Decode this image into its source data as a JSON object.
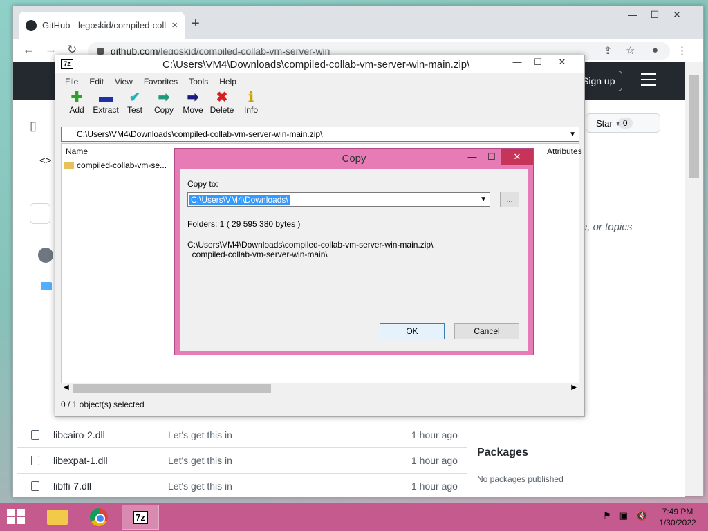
{
  "browser": {
    "tab_title": "GitHub - legoskid/compiled-collab-vm-server-win",
    "tab_close": "×",
    "new_tab": "+",
    "url_host": "github.com",
    "url_path": "/legoskid/compiled-collab-vm-server-win",
    "win_min": "—",
    "win_max": "☐",
    "win_close": "✕"
  },
  "github": {
    "sign_up": "Sign up",
    "star_label": "Star",
    "star_count": "0",
    "topics_text": "site, or topics",
    "code_tab_icon": "<>",
    "files": [
      {
        "name": "libcairo-2.dll",
        "message": "Let's get this in",
        "time": "1 hour ago"
      },
      {
        "name": "libexpat-1.dll",
        "message": "Let's get this in",
        "time": "1 hour ago"
      },
      {
        "name": "libffi-7.dll",
        "message": "Let's get this in",
        "time": "1 hour ago"
      }
    ],
    "packages_heading": "Packages",
    "packages_empty": "No packages published"
  },
  "zip": {
    "icon_text": "7z",
    "title": "C:\\Users\\VM4\\Downloads\\compiled-collab-vm-server-win-main.zip\\",
    "menu": [
      "File",
      "Edit",
      "View",
      "Favorites",
      "Tools",
      "Help"
    ],
    "tools": [
      {
        "label": "Add",
        "icon": "plus-icon",
        "glyph": "✚",
        "color": "#2aa52a"
      },
      {
        "label": "Extract",
        "icon": "minus-icon",
        "glyph": "▬",
        "color": "#1f2fa8"
      },
      {
        "label": "Test",
        "icon": "test-check-icon",
        "glyph": "✔",
        "color": "#22b5b5"
      },
      {
        "label": "Copy",
        "icon": "copy-arrow-icon",
        "glyph": "➡",
        "color": "#1e9a7a"
      },
      {
        "label": "Move",
        "icon": "move-arrow-icon",
        "glyph": "➡",
        "color": "#1a1a80"
      },
      {
        "label": "Delete",
        "icon": "delete-x-icon",
        "glyph": "✖",
        "color": "#d42020"
      },
      {
        "label": "Info",
        "icon": "info-icon",
        "glyph": "ℹ",
        "color": "#c9a400"
      }
    ],
    "address": "C:\\Users\\VM4\\Downloads\\compiled-collab-vm-server-win-main.zip\\",
    "col_name": "Name",
    "col_attributes": "Attributes",
    "item_name": "compiled-collab-vm-se...",
    "status": "0 / 1 object(s) selected"
  },
  "copy_dialog": {
    "title": "Copy",
    "copy_to_label": "Copy to:",
    "copy_to_value": "C:\\Users\\VM4\\Downloads\\",
    "browse_label": "...",
    "folders_info": "Folders: 1    ( 29 595 380 bytes )",
    "path_line1": "C:\\Users\\VM4\\Downloads\\compiled-collab-vm-server-win-main.zip\\",
    "path_line2": "  compiled-collab-vm-server-win-main\\",
    "ok_label": "OK",
    "cancel_label": "Cancel"
  },
  "taskbar": {
    "clock_time": "7:49 PM",
    "clock_date": "1/30/2022",
    "accent": "#c45a8e"
  }
}
